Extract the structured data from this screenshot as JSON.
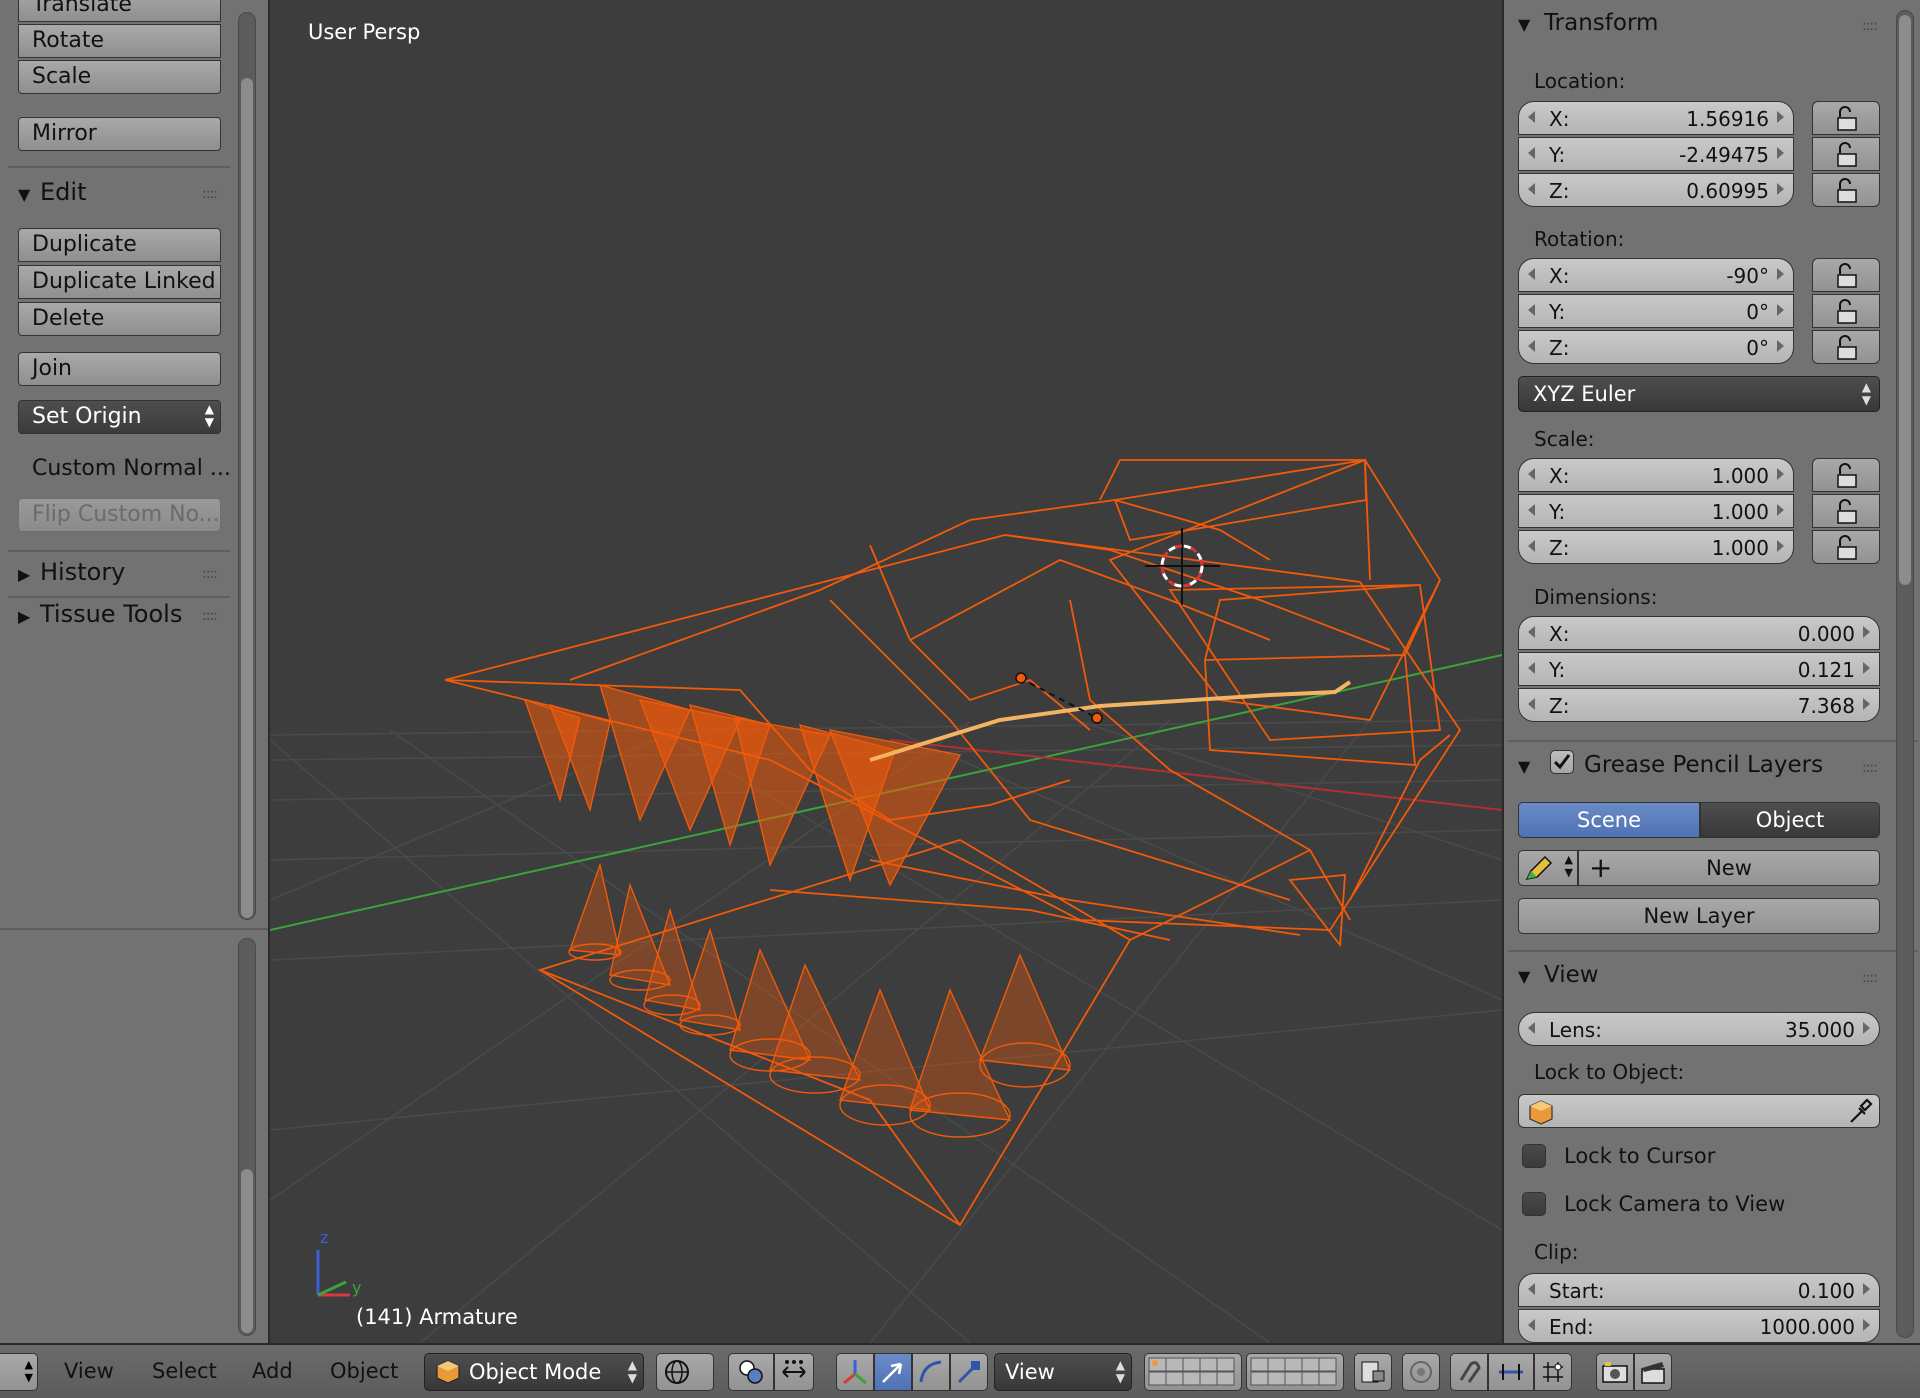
{
  "left_panel": {
    "transform_buttons": [
      "Translate",
      "Rotate",
      "Scale"
    ],
    "mirror_label": "Mirror",
    "edit_section": {
      "title": "Edit",
      "buttons": [
        "Duplicate",
        "Duplicate Linked",
        "Delete"
      ],
      "join_label": "Join",
      "set_origin_label": "Set Origin",
      "custom_normal_label": "Custom Normal ...",
      "flip_custom_label": "Flip Custom No..."
    },
    "history_title": "History",
    "tissue_tools_title": "Tissue Tools"
  },
  "viewport": {
    "view_label": "User Persp",
    "object_label": "(141) Armature",
    "axis_z": "z",
    "axis_y": "y",
    "wire_color": "#f05a0a",
    "bone_color": "#f2b463"
  },
  "right_panel": {
    "transform": {
      "title": "Transform",
      "location_label": "Location:",
      "location": [
        {
          "axis": "X:",
          "value": "1.56916"
        },
        {
          "axis": "Y:",
          "value": "-2.49475"
        },
        {
          "axis": "Z:",
          "value": "0.60995"
        }
      ],
      "rotation_label": "Rotation:",
      "rotation": [
        {
          "axis": "X:",
          "value": "-90°"
        },
        {
          "axis": "Y:",
          "value": "0°"
        },
        {
          "axis": "Z:",
          "value": "0°"
        }
      ],
      "rotation_mode": "XYZ Euler",
      "scale_label": "Scale:",
      "scale": [
        {
          "axis": "X:",
          "value": "1.000"
        },
        {
          "axis": "Y:",
          "value": "1.000"
        },
        {
          "axis": "Z:",
          "value": "1.000"
        }
      ],
      "dimensions_label": "Dimensions:",
      "dimensions": [
        {
          "axis": "X:",
          "value": "0.000"
        },
        {
          "axis": "Y:",
          "value": "0.121"
        },
        {
          "axis": "Z:",
          "value": "7.368"
        }
      ]
    },
    "grease_pencil": {
      "title": "Grease Pencil Layers",
      "scene_tab": "Scene",
      "object_tab": "Object",
      "new_label": "New",
      "new_layer_label": "New Layer"
    },
    "view": {
      "title": "View",
      "lens_label": "Lens:",
      "lens_value": "35.000",
      "lock_to_object_label": "Lock to Object:",
      "lock_to_cursor_label": "Lock to Cursor",
      "lock_camera_label": "Lock Camera to View",
      "clip_label": "Clip:",
      "clip_start_label": "Start:",
      "clip_start_value": "0.100",
      "clip_end_label": "End:",
      "clip_end_value": "1000.000"
    }
  },
  "bottom_bar": {
    "menus": [
      "View",
      "Select",
      "Add",
      "Object"
    ],
    "mode_label": "Object Mode",
    "orientation_label": "View",
    "accent_color": "#5a7fc0"
  }
}
